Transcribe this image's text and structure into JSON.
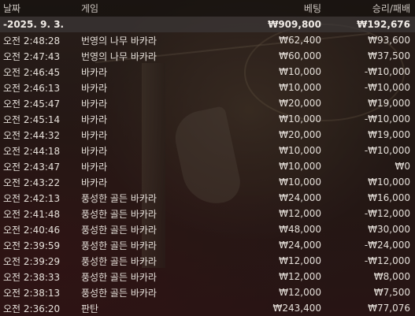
{
  "header": {
    "date": "날짜",
    "game": "게임",
    "bet": "베팅",
    "result": "승리/패배"
  },
  "date_group": {
    "label": "-2025. 9. 3.",
    "bet": "₩909,800",
    "result": "₩192,676"
  },
  "rows": [
    {
      "time": "오전 2:48:28",
      "game": "번영의 나무 바카라",
      "bet": "₩62,400",
      "result": "₩93,600"
    },
    {
      "time": "오전 2:47:43",
      "game": "번영의 나무 바카라",
      "bet": "₩60,000",
      "result": "₩37,500"
    },
    {
      "time": "오전 2:46:45",
      "game": "바카라",
      "bet": "₩10,000",
      "result": "-₩10,000"
    },
    {
      "time": "오전 2:46:13",
      "game": "바카라",
      "bet": "₩10,000",
      "result": "-₩10,000"
    },
    {
      "time": "오전 2:45:47",
      "game": "바카라",
      "bet": "₩20,000",
      "result": "₩19,000"
    },
    {
      "time": "오전 2:45:14",
      "game": "바카라",
      "bet": "₩10,000",
      "result": "-₩10,000"
    },
    {
      "time": "오전 2:44:32",
      "game": "바카라",
      "bet": "₩20,000",
      "result": "₩19,000"
    },
    {
      "time": "오전 2:44:18",
      "game": "바카라",
      "bet": "₩10,000",
      "result": "-₩10,000"
    },
    {
      "time": "오전 2:43:47",
      "game": "바카라",
      "bet": "₩10,000",
      "result": "₩0"
    },
    {
      "time": "오전 2:43:22",
      "game": "바카라",
      "bet": "₩10,000",
      "result": "₩10,000"
    },
    {
      "time": "오전 2:42:13",
      "game": "풍성한 골든 바카라",
      "bet": "₩24,000",
      "result": "₩16,000"
    },
    {
      "time": "오전 2:41:48",
      "game": "풍성한 골든 바카라",
      "bet": "₩12,000",
      "result": "-₩12,000"
    },
    {
      "time": "오전 2:40:46",
      "game": "풍성한 골든 바카라",
      "bet": "₩48,000",
      "result": "₩30,000"
    },
    {
      "time": "오전 2:39:59",
      "game": "풍성한 골든 바카라",
      "bet": "₩24,000",
      "result": "-₩24,000"
    },
    {
      "time": "오전 2:39:29",
      "game": "풍성한 골든 바카라",
      "bet": "₩12,000",
      "result": "-₩12,000"
    },
    {
      "time": "오전 2:38:33",
      "game": "풍성한 골든 바카라",
      "bet": "₩12,000",
      "result": "₩8,000"
    },
    {
      "time": "오전 2:38:13",
      "game": "풍성한 골든 바카라",
      "bet": "₩12,000",
      "result": "₩7,500"
    },
    {
      "time": "오전 2:36:20",
      "game": "판탄",
      "bet": "₩243,400",
      "result": "₩77,076"
    }
  ]
}
